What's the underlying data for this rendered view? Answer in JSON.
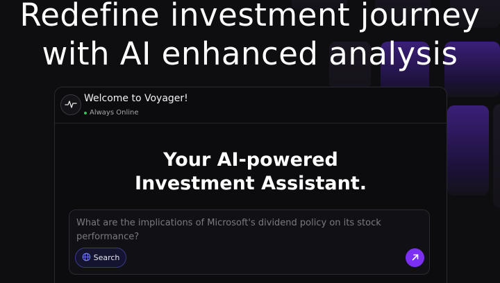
{
  "hero": {
    "title_line1": "Redefine investment journey",
    "title_line2": "with AI enhanced analysis"
  },
  "chat": {
    "welcome": "Welcome to Voyager!",
    "status": "Always Online",
    "assistant_title_line1": "Your AI-powered",
    "assistant_title_line2": "Investment Assistant.",
    "prompt_text": "What are the implications of Microsoft's dividend policy on its stock performance?",
    "search_label": "Search"
  },
  "icons": {
    "avatar": "pulse-icon",
    "search": "globe-icon",
    "send": "arrow-up-right-icon"
  },
  "colors": {
    "accent": "#7b2ff2",
    "status_online": "#35c45a",
    "background": "#0e0d10"
  }
}
